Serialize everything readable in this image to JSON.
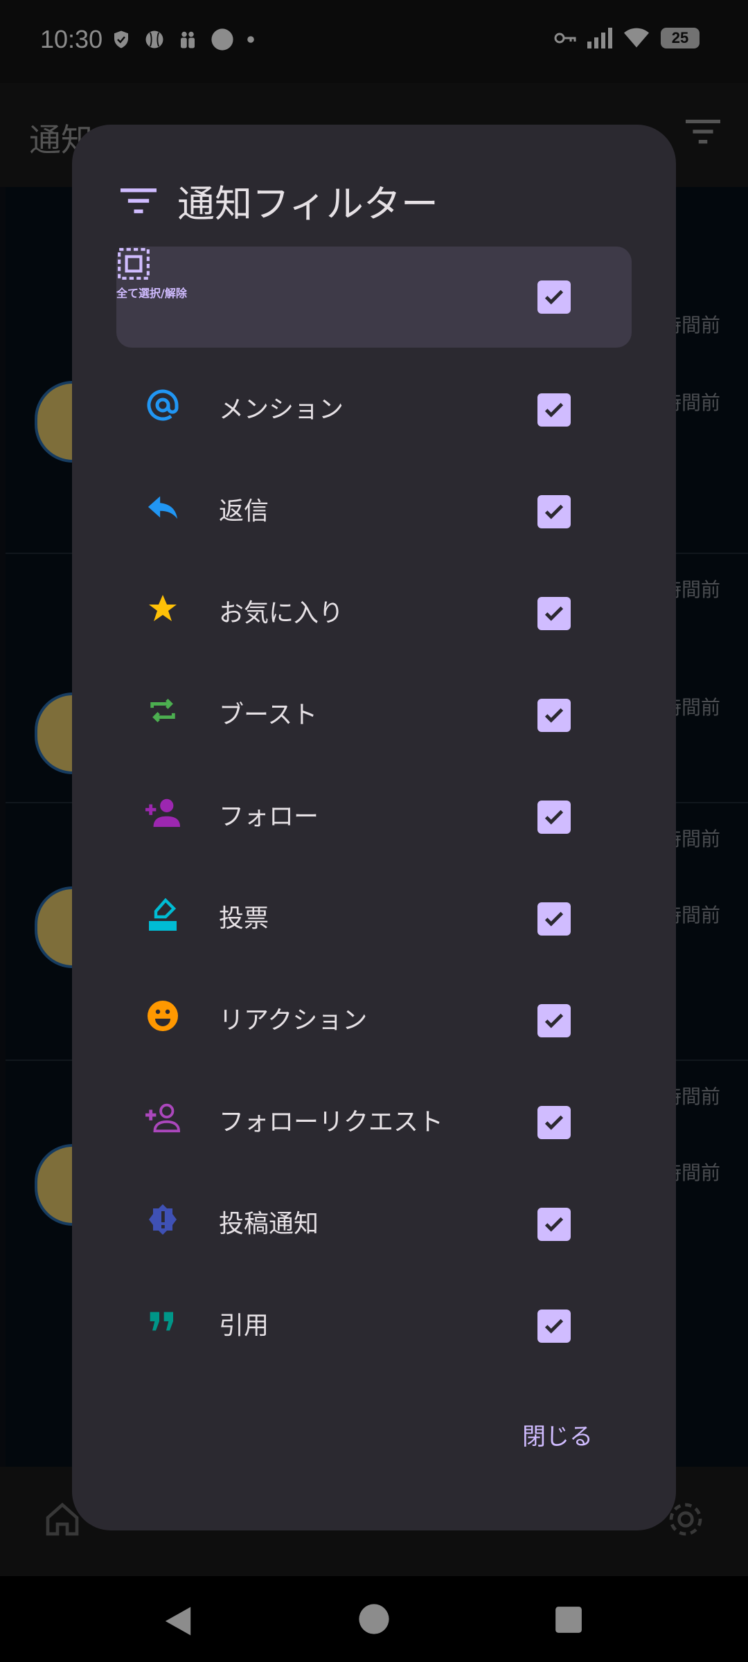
{
  "status_bar": {
    "time": "10:30",
    "battery": "25"
  },
  "app": {
    "title": "通知",
    "bg_times": [
      "時間前",
      "時間前",
      "時間前",
      "時間前",
      "時間前",
      "時間前",
      "時間前",
      "時間前"
    ]
  },
  "dialog": {
    "title": "通知フィルター",
    "select_all": {
      "label": "全て選択/解除",
      "checked": true
    },
    "items": [
      {
        "label": "メンション",
        "icon": "at-icon",
        "color": "#2196f3",
        "checked": true
      },
      {
        "label": "返信",
        "icon": "reply-icon",
        "color": "#2196f3",
        "checked": true
      },
      {
        "label": "お気に入り",
        "icon": "star-icon",
        "color": "#ffc107",
        "checked": true
      },
      {
        "label": "ブースト",
        "icon": "repeat-icon",
        "color": "#4caf50",
        "checked": true
      },
      {
        "label": "フォロー",
        "icon": "person-add-icon",
        "color": "#9c27b0",
        "checked": true
      },
      {
        "label": "投票",
        "icon": "ballot-icon",
        "color": "#00bcd4",
        "checked": true
      },
      {
        "label": "リアクション",
        "icon": "emoji-icon",
        "color": "#ff9800",
        "checked": true
      },
      {
        "label": "フォローリクエスト",
        "icon": "person-add-outline-icon",
        "color": "#ab47bc",
        "checked": true
      },
      {
        "label": "投稿通知",
        "icon": "alert-badge-icon",
        "color": "#3f51b5",
        "checked": true
      },
      {
        "label": "引用",
        "icon": "quote-icon",
        "color": "#009688",
        "checked": true
      }
    ],
    "close_label": "閉じる"
  },
  "colors": {
    "accent": "#d0bcff",
    "dialog_bg": "#2b2930"
  }
}
